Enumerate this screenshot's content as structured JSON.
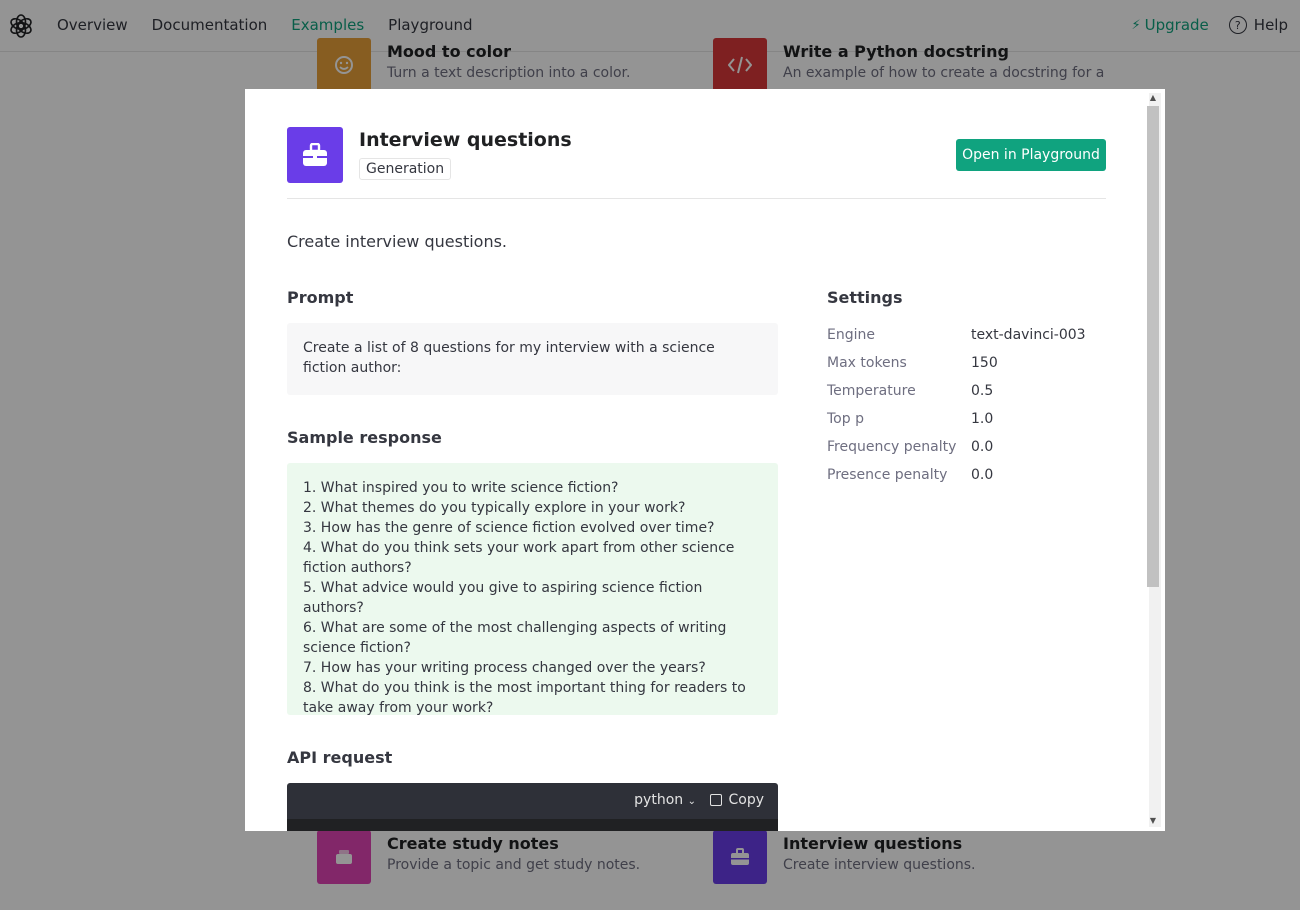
{
  "nav": {
    "links": [
      "Overview",
      "Documentation",
      "Examples",
      "Playground"
    ],
    "active": "Examples",
    "upgrade": "Upgrade",
    "help": "Help"
  },
  "background": {
    "cards": [
      {
        "title": "Mood to color",
        "desc": "Turn a text description into a color.",
        "color": "#e8a03a",
        "icon": "smiley-icon"
      },
      {
        "title": "Write a Python docstring",
        "desc": "An example of how to create a docstring for a",
        "color": "#d9383a",
        "icon": "code-icon"
      },
      {
        "title": "Create study notes",
        "desc": "Provide a topic and get study notes.",
        "color": "#e044b5",
        "icon": "notes-icon"
      },
      {
        "title": "Interview questions",
        "desc": "Create interview questions.",
        "color": "#6a3de8",
        "icon": "briefcase-icon"
      }
    ]
  },
  "modal": {
    "title": "Interview questions",
    "tag": "Generation",
    "open_button": "Open in Playground",
    "description": "Create interview questions.",
    "prompt_heading": "Prompt",
    "prompt": "Create a list of 8 questions for my interview with a science fiction author:",
    "response_heading": "Sample response",
    "response": [
      "1. What inspired you to write science fiction?",
      "2. What themes do you typically explore in your work?",
      "3. How has the genre of science fiction evolved over time?",
      "4. What do you think sets your work apart from other science fiction authors?",
      "5. What advice would you give to aspiring science fiction authors?",
      "6. What are some of the most challenging aspects of writing science fiction?",
      "7. How has your writing process changed over the years?",
      "8. What do you think is the most important thing for readers to take away from your work?"
    ],
    "api_heading": "API request",
    "code_language": "python",
    "copy_label": "Copy",
    "settings_heading": "Settings",
    "settings": [
      {
        "key": "Engine",
        "value": "text-davinci-003"
      },
      {
        "key": "Max tokens",
        "value": "150"
      },
      {
        "key": "Temperature",
        "value": "0.5"
      },
      {
        "key": "Top p",
        "value": "1.0"
      },
      {
        "key": "Frequency penalty",
        "value": "0.0"
      },
      {
        "key": "Presence penalty",
        "value": "0.0"
      }
    ]
  }
}
